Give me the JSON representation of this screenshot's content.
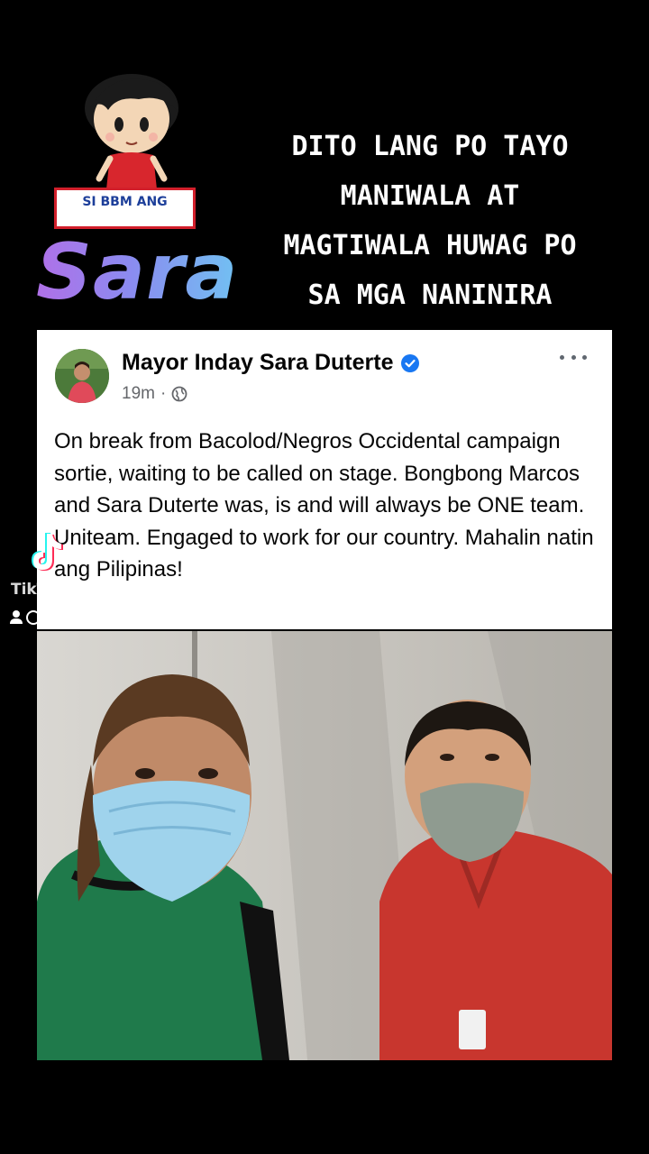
{
  "overlay": {
    "cartoon_banner": "SI BBM ANG",
    "sara_word": "Sara",
    "headline_lines": [
      "DITO LANG PO TAYO",
      "MANIWALA AT",
      "MAGTIWALA HUWAG PO",
      "SA MGA NANINIRA"
    ]
  },
  "post": {
    "author": "Mayor Inday Sara Duterte",
    "time": "19m",
    "audience_icon": "globe-icon",
    "menu_icon": "more-dots-icon",
    "verified_icon": "verified-badge-icon",
    "text": "On break from Bacolod/Negros Occidental campaign sortie, waiting to be called on stage. Bongbong Marcos and Sara Duterte was, is and will always be ONE team. Uniteam. Engaged to work for our country. Mahalin natin ang Pilipinas!"
  },
  "watermark": {
    "app_name": "TikTok",
    "logo_icon": "tiktok-logo-icon",
    "user_icon": "user-icon"
  },
  "colors": {
    "background": "#000000",
    "banner_border": "#d21f2b",
    "banner_text": "#1d3f9a",
    "verified_blue": "#1877f2",
    "meta_gray": "#65676b"
  }
}
